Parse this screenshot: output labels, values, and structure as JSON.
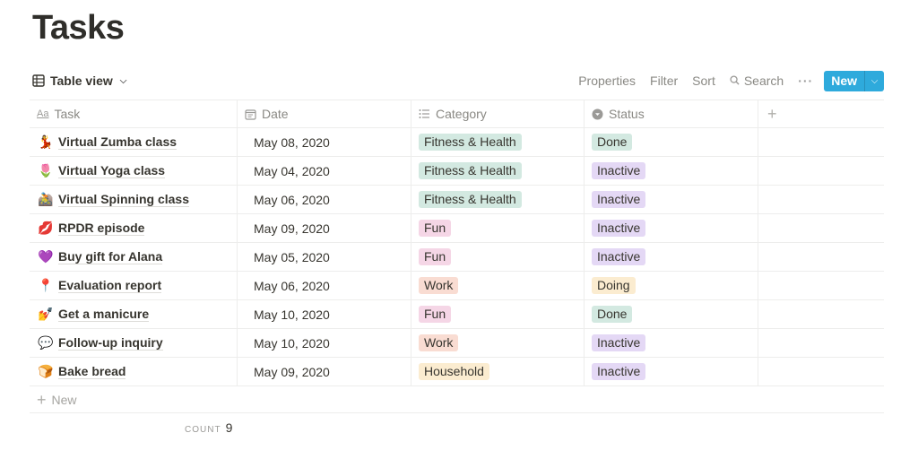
{
  "page": {
    "title": "Tasks"
  },
  "toolbar": {
    "view_label": "Table view",
    "properties": "Properties",
    "filter": "Filter",
    "sort": "Sort",
    "search": "Search",
    "more": "···",
    "new": "New",
    "accent": "#2eaadc"
  },
  "table": {
    "columns": [
      {
        "label": "Task",
        "icon": "text-property-icon"
      },
      {
        "label": "Date",
        "icon": "calendar-icon"
      },
      {
        "label": "Category",
        "icon": "list-icon"
      },
      {
        "label": "Status",
        "icon": "select-icon"
      }
    ],
    "add_column": "+",
    "rows": [
      {
        "emoji": "💃",
        "task": "Virtual Zumba class",
        "date": "May 08, 2020",
        "category": "Fitness & Health",
        "status": "Done"
      },
      {
        "emoji": "🌷",
        "task": "Virtual Yoga class",
        "date": "May 04, 2020",
        "category": "Fitness & Health",
        "status": "Inactive"
      },
      {
        "emoji": "🚵",
        "task": "Virtual Spinning class",
        "date": "May 06, 2020",
        "category": "Fitness & Health",
        "status": "Inactive"
      },
      {
        "emoji": "💋",
        "task": "RPDR episode",
        "date": "May 09, 2020",
        "category": "Fun",
        "status": "Inactive"
      },
      {
        "emoji": "💜",
        "task": "Buy gift for Alana",
        "date": "May 05, 2020",
        "category": "Fun",
        "status": "Inactive"
      },
      {
        "emoji": "📍",
        "task": "Evaluation report",
        "date": "May 06, 2020",
        "category": "Work",
        "status": "Doing"
      },
      {
        "emoji": "💅",
        "task": "Get a manicure",
        "date": "May 10, 2020",
        "category": "Fun",
        "status": "Done"
      },
      {
        "emoji": "💬",
        "task": "Follow-up inquiry",
        "date": "May 10, 2020",
        "category": "Work",
        "status": "Inactive"
      },
      {
        "emoji": "🍞",
        "task": "Bake bread",
        "date": "May 09, 2020",
        "category": "Household",
        "status": "Inactive"
      }
    ],
    "new_row_label": "New",
    "category_colors": {
      "Fitness & Health": "#d3e9e1",
      "Fun": "#f5d6e6",
      "Work": "#f9dcd2",
      "Household": "#fbecd0"
    },
    "status_colors": {
      "Done": "#d3e9e1",
      "Inactive": "#e4d8f5",
      "Doing": "#fbecd0"
    }
  },
  "footer": {
    "count_label": "COUNT",
    "count_value": "9"
  }
}
